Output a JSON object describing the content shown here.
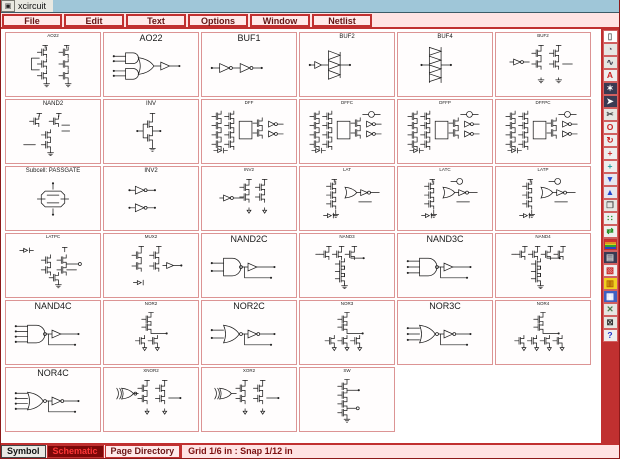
{
  "window": {
    "title": "xcircuit",
    "icon_glyph": "▣"
  },
  "menubar": {
    "items": [
      {
        "label": "File"
      },
      {
        "label": "Edit"
      },
      {
        "label": "Text"
      },
      {
        "label": "Options"
      },
      {
        "label": "Window"
      },
      {
        "label": "Netlist"
      }
    ]
  },
  "library": {
    "cells": [
      {
        "label": "AO22",
        "size": "tiny",
        "symbol": "ao22s"
      },
      {
        "label": "AO22",
        "size": "large",
        "symbol": "ao22g"
      },
      {
        "label": "BUF1",
        "size": "large",
        "symbol": "buf1"
      },
      {
        "label": "BUF2",
        "size": "small",
        "symbol": "buf2"
      },
      {
        "label": "BUF4",
        "size": "small",
        "symbol": "buf4"
      },
      {
        "label": "BUF2",
        "size": "tiny",
        "symbol": "buf2s"
      },
      {
        "label": "NAND2",
        "size": "small",
        "symbol": "nand2s"
      },
      {
        "label": "INV",
        "size": "small",
        "symbol": "invs"
      },
      {
        "label": "DFF",
        "size": "tiny",
        "symbol": "dff"
      },
      {
        "label": "DFFC",
        "size": "tiny",
        "symbol": "dffc"
      },
      {
        "label": "DFFP",
        "size": "tiny",
        "symbol": "dffc"
      },
      {
        "label": "DFFPC",
        "size": "tiny",
        "symbol": "dffc"
      },
      {
        "label": "Subcell: PASSGATE",
        "size": "small",
        "symbol": "pass"
      },
      {
        "label": "INV2",
        "size": "small",
        "symbol": "inv2"
      },
      {
        "label": "INV2",
        "size": "tiny",
        "symbol": "inv2s"
      },
      {
        "label": "LAT",
        "size": "tiny",
        "symbol": "lat"
      },
      {
        "label": "LATC",
        "size": "tiny",
        "symbol": "latc"
      },
      {
        "label": "LATP",
        "size": "tiny",
        "symbol": "latc"
      },
      {
        "label": "LATPC",
        "size": "tiny",
        "symbol": "latpc"
      },
      {
        "label": "MUX2",
        "size": "tiny",
        "symbol": "mux2"
      },
      {
        "label": "NAND2C",
        "size": "large",
        "symbol": "nand2c"
      },
      {
        "label": "NAND3",
        "size": "tiny",
        "symbol": "nand3s"
      },
      {
        "label": "NAND3C",
        "size": "large",
        "symbol": "nand3c"
      },
      {
        "label": "NAND4",
        "size": "tiny",
        "symbol": "nand4s"
      },
      {
        "label": "NAND4C",
        "size": "large",
        "symbol": "nand4c"
      },
      {
        "label": "NOR2",
        "size": "tiny",
        "symbol": "nor2s"
      },
      {
        "label": "NOR2C",
        "size": "large",
        "symbol": "nor2c"
      },
      {
        "label": "NOR3",
        "size": "tiny",
        "symbol": "nor3s"
      },
      {
        "label": "NOR3C",
        "size": "large",
        "symbol": "nor3c"
      },
      {
        "label": "NOR4",
        "size": "tiny",
        "symbol": "nor4s"
      },
      {
        "label": "NOR4C",
        "size": "large",
        "symbol": "nor4c"
      },
      {
        "label": "XNOR2",
        "size": "tiny",
        "symbol": "xnor2s"
      },
      {
        "label": "XOR2",
        "size": "tiny",
        "symbol": "xor2s"
      },
      {
        "label": "SW",
        "size": "tiny",
        "symbol": "sws"
      }
    ]
  },
  "toolbar": {
    "buttons": [
      {
        "name": "page-icon",
        "glyph": "▯",
        "fg": "#666666",
        "bg": "#ffffff"
      },
      {
        "name": "pan-icon",
        "glyph": "◔",
        "fg": "#555566",
        "bg": "#e6e6e2"
      },
      {
        "name": "spline-icon",
        "glyph": "∿",
        "fg": "#333344",
        "bg": "#e6e6e2"
      },
      {
        "name": "text-icon",
        "glyph": "A",
        "fg": "#cc2222",
        "bg": "#eeeeee"
      },
      {
        "name": "polygon-icon",
        "glyph": "✶",
        "fg": "#ffffff",
        "bg": "#3a3a52"
      },
      {
        "name": "move-icon",
        "glyph": "➤",
        "fg": "#ffffff",
        "bg": "#3a3a52"
      },
      {
        "name": "delete-icon",
        "glyph": "✂",
        "fg": "#444444",
        "bg": "#e6e6e2"
      },
      {
        "name": "ellipse-icon",
        "glyph": "O",
        "fg": "#cc2222",
        "bg": "#eeeeee"
      },
      {
        "name": "rotate-icon",
        "glyph": "↻",
        "fg": "#cc2222",
        "bg": "#eeeeee"
      },
      {
        "name": "flip-horizontal-icon",
        "glyph": "+",
        "fg": "#cc2222",
        "bg": "#eeeeee"
      },
      {
        "name": "flip-vertical-icon",
        "glyph": "+",
        "fg": "#1a9a9a",
        "bg": "#eeeeee"
      },
      {
        "name": "push-icon",
        "glyph": "▼",
        "fg": "#2244cc",
        "bg": "#e6e6ee"
      },
      {
        "name": "pop-icon",
        "glyph": "▲",
        "fg": "#2244cc",
        "bg": "#e6e6ee"
      },
      {
        "name": "copy-icon",
        "glyph": "❐",
        "fg": "#555555",
        "bg": "#e6e6e2"
      },
      {
        "name": "join-icon",
        "glyph": "∷",
        "fg": "#1a8a1a",
        "bg": "#eeeeee"
      },
      {
        "name": "unjoin-icon",
        "glyph": "⇄",
        "fg": "#1a8a1a",
        "bg": "#eeeeee"
      },
      {
        "name": "colors-icon",
        "stripes": [
          "#d03030",
          "#e09020",
          "#d8d020",
          "#30a030",
          "#3040c0"
        ]
      },
      {
        "name": "borders-icon",
        "glyph": "▤",
        "fg": "#cccccc",
        "bg": "#3a3a52"
      },
      {
        "name": "fill-icon",
        "glyph": "▧",
        "fg": "#cc2222",
        "bg": "#eeeeee"
      },
      {
        "name": "library-icon",
        "glyph": "▥",
        "fg": "#b06000",
        "bg": "#f0d020"
      },
      {
        "name": "pagedir-icon",
        "glyph": "▦",
        "fg": "#ffffff",
        "bg": "#4060c0"
      },
      {
        "name": "yank-icon",
        "glyph": "✕",
        "fg": "#4a7a4a",
        "bg": "#e6e6e2"
      },
      {
        "name": "cut-icon",
        "glyph": "⊠",
        "fg": "#333333",
        "bg": "#e6e6e2"
      },
      {
        "name": "help-icon",
        "glyph": "?",
        "fg": "#2233cc",
        "bg": "#eeeeee"
      }
    ]
  },
  "statusbar": {
    "modes": [
      {
        "label": "Symbol",
        "active": false
      },
      {
        "label": "Schematic",
        "active": true
      },
      {
        "label": "Page Directory",
        "active": false
      }
    ],
    "message": "Grid 1/6 in : Snap 1/12 in"
  },
  "colors": {
    "accent_red": "#c03030",
    "panel_pink": "#ffe3e3",
    "titlebar_blue": "#9fc6d8",
    "active_mode_bg": "#7c0808",
    "active_mode_fg": "#ff3838",
    "cell_border": "#dc9494"
  }
}
